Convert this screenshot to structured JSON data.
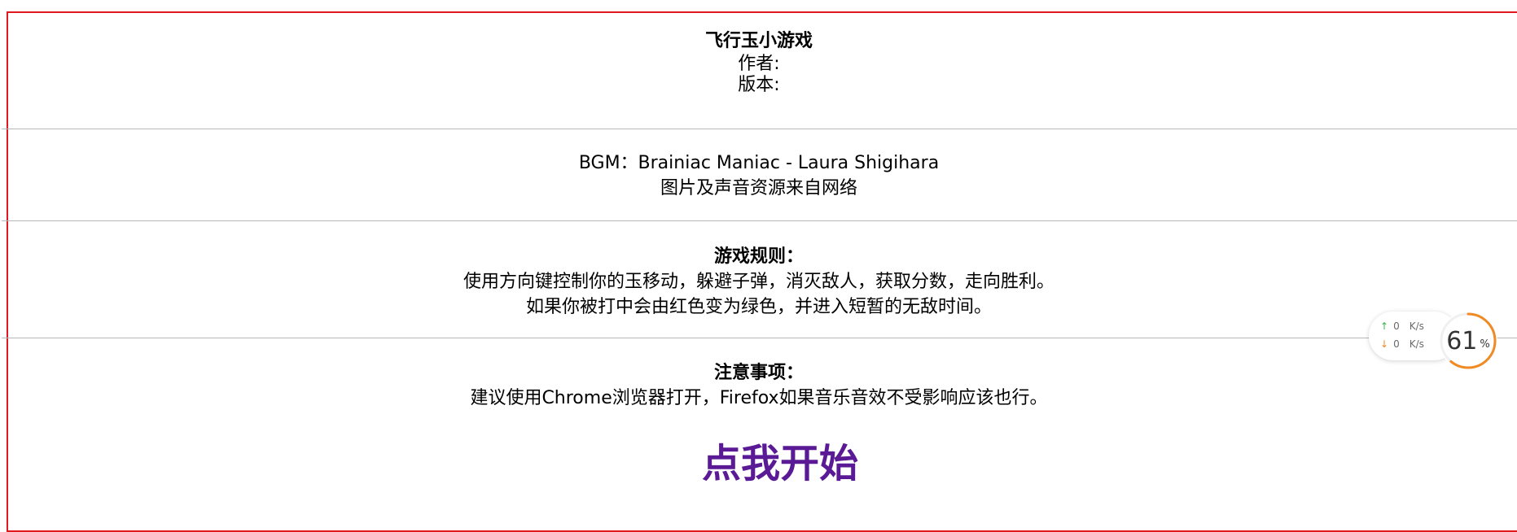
{
  "header": {
    "title": "飞行玉小游戏",
    "author_label": "作者:",
    "version_label": "版本:"
  },
  "credits": {
    "bgm": "BGM：Brainiac Maniac - Laura Shigihara",
    "resources": "图片及声音资源来自网络"
  },
  "rules": {
    "heading": "游戏规则：",
    "line1": "使用方向键控制你的玉移动，躲避子弹，消灭敌人，获取分数，走向胜利。",
    "line2": "如果你被打中会由红色变为绿色，并进入短暂的无敌时间。"
  },
  "notes": {
    "heading": "注意事项：",
    "line1": "建议使用Chrome浏览器打开，Firefox如果音乐音效不受影响应该也行。"
  },
  "start": {
    "label": "点我开始"
  },
  "widget": {
    "upload_value": "0",
    "download_value": "0",
    "unit": "K/s",
    "cpu_percent": "61",
    "percent_sign": "%",
    "up_icon": "arrow-up-icon",
    "down_icon": "arrow-down-icon",
    "accent_color": "#f08a24"
  },
  "colors": {
    "frame_border": "#e0191f",
    "start_link": "#5a1a95",
    "divider": "#b8b8b8"
  }
}
